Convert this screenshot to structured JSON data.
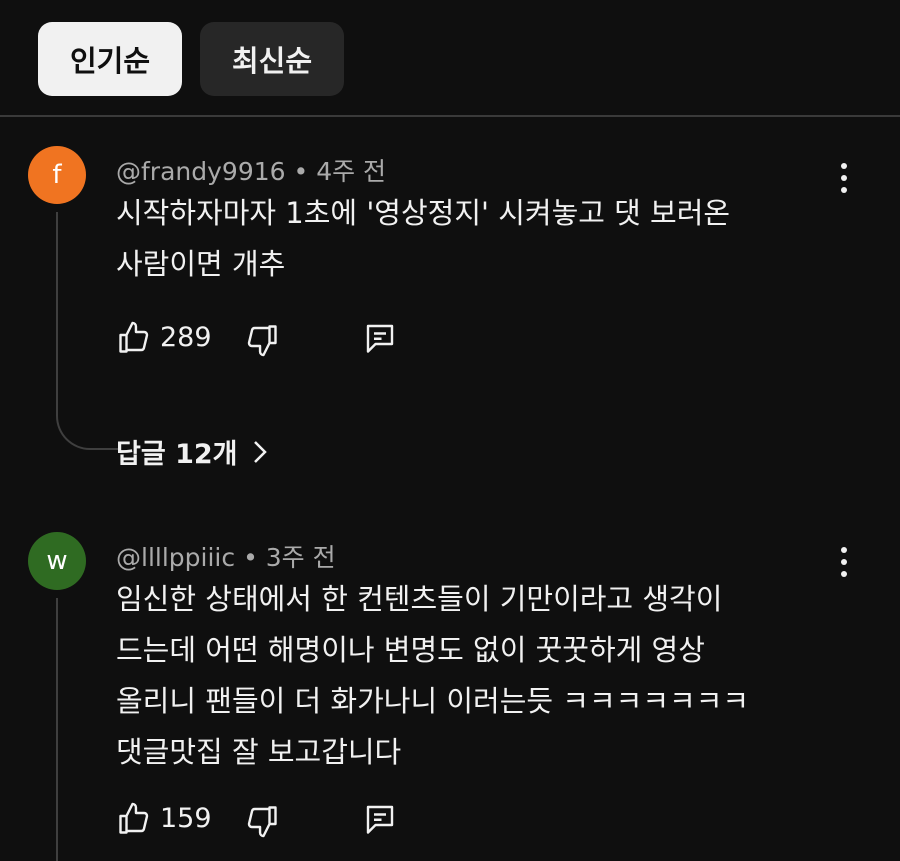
{
  "filters": {
    "popular": "인기순",
    "newest": "최신순"
  },
  "comments": [
    {
      "avatar_letter": "f",
      "avatar_color": "#f07421",
      "author": "@frandy9916",
      "separator": "•",
      "time": "4주 전",
      "lines": [
        "시작하자마자 1초에 '영상정지' 시켜놓고 댓 보러온",
        "사람이면 개추"
      ],
      "likes": "289",
      "replies_label": "답글 12개"
    },
    {
      "avatar_letter": "w",
      "avatar_color": "#2f6b22",
      "author": "@llllppiiic",
      "separator": "•",
      "time": "3주 전",
      "lines": [
        "임신한 상태에서 한 컨텐츠들이 기만이라고 생각이",
        "드는데 어떤 해명이나 변명도 없이  꿋꿋하게 영상",
        "올리니 팬들이 더 화가나니 이러는듯 ㅋㅋㅋㅋㅋㅋㅋ",
        "댓글맛집 잘 보고갑니다"
      ],
      "likes": "159"
    }
  ],
  "icons": {
    "like": "thumbs-up-icon",
    "dislike": "thumbs-down-icon",
    "reply": "reply-icon",
    "more": "more-vertical-icon",
    "chevron": "chevron-right-icon"
  }
}
